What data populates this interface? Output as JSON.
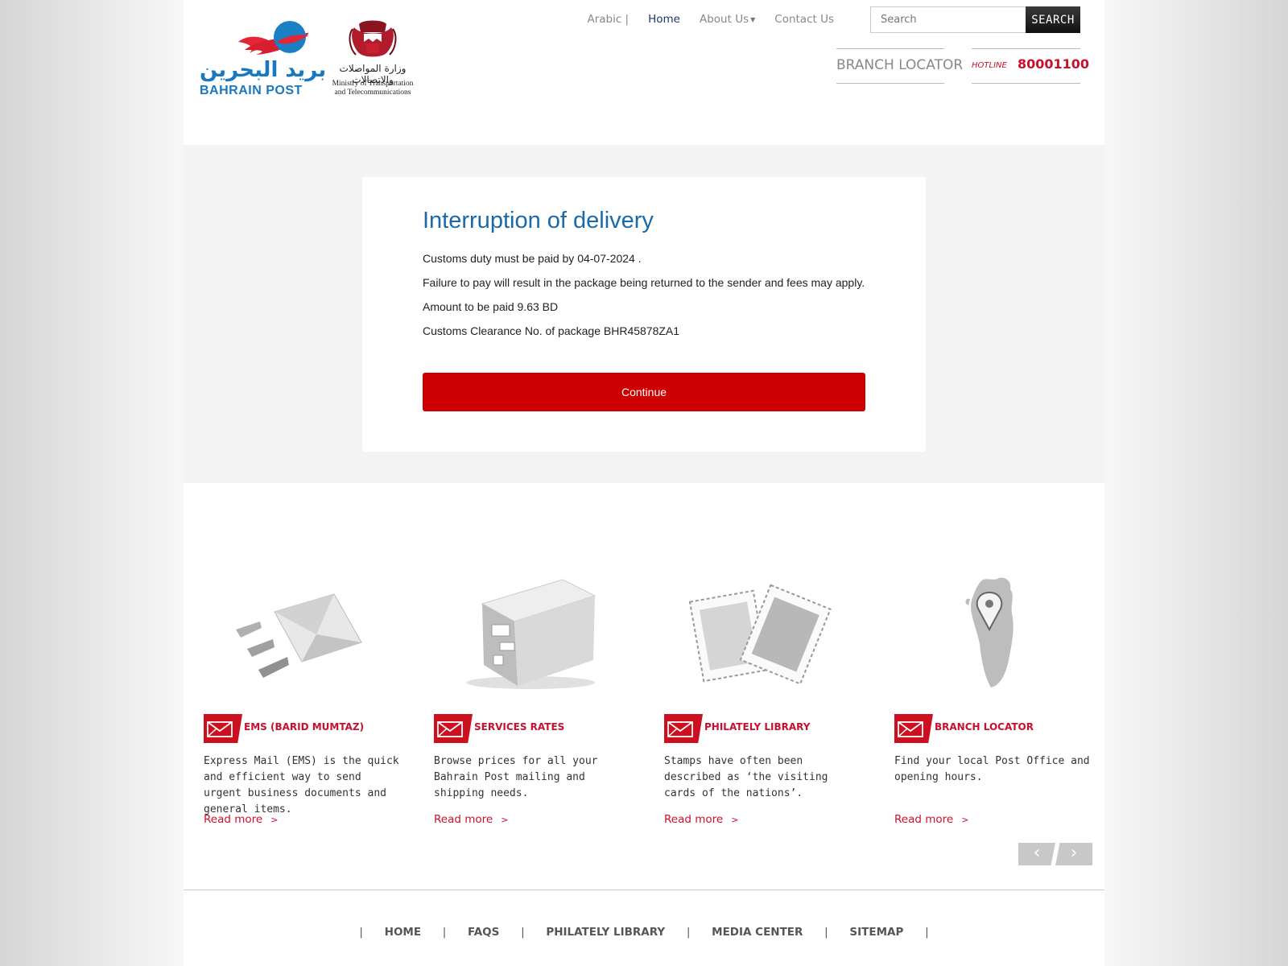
{
  "header": {
    "logo_post_ar": "بريد البحرين",
    "logo_post_en": "BAHRAIN POST",
    "logo_ministry_ar": "وزارة المواصلات والاتصالات",
    "logo_ministry_en1": "Ministry of Transportation",
    "logo_ministry_en2": "and Telecommunications",
    "nav": {
      "arabic": "Arabic |",
      "home": "Home",
      "about": "About Us",
      "contact": "Contact Us"
    },
    "search_placeholder": "Search",
    "search_button": "SEARCH",
    "branch_locator": "BRANCH LOCATOR",
    "hotline_label": "HOTLINE",
    "hotline_number": "80001100"
  },
  "alert": {
    "title": "Interruption of delivery",
    "line1": "Customs duty must be paid by 04-07-2024 .",
    "line2": "Failure to pay will result in the package being returned to the sender and fees may apply.",
    "line3": "Amount to be paid 9.63 BD",
    "line4": "Customs Clearance No. of package BHR45878ZA1",
    "continue_label": "Continue"
  },
  "services": [
    {
      "title": "EMS (BARID MUMTAZ)",
      "desc": "Express Mail (EMS) is the quick and efficient way to send urgent business documents and general items.",
      "more": "Read more",
      "icon": "envelope-illustration"
    },
    {
      "title": "SERVICES RATES",
      "desc": "Browse prices for all your Bahrain Post mailing and shipping needs.",
      "more": "Read more",
      "icon": "parcel-box-illustration"
    },
    {
      "title": "PHILATELY LIBRARY",
      "desc": "Stamps have often been described as ‘the visiting cards of the nations’.",
      "more": "Read more",
      "icon": "stamps-illustration"
    },
    {
      "title": "BRANCH LOCATOR",
      "desc": "Find your local Post Office and opening hours.",
      "more": "Read more",
      "icon": "map-pin-illustration"
    }
  ],
  "carousel": {
    "prev": "‹",
    "next": "›"
  },
  "footer": {
    "links": [
      "HOME",
      "FAQS",
      "PHILATELY LIBRARY",
      "MEDIA CENTER",
      "SITEMAP"
    ],
    "separator": "|"
  },
  "colors": {
    "accent_red": "#cc0000",
    "brand_blue": "#1a6aaa",
    "title_red": "#c8102e"
  }
}
